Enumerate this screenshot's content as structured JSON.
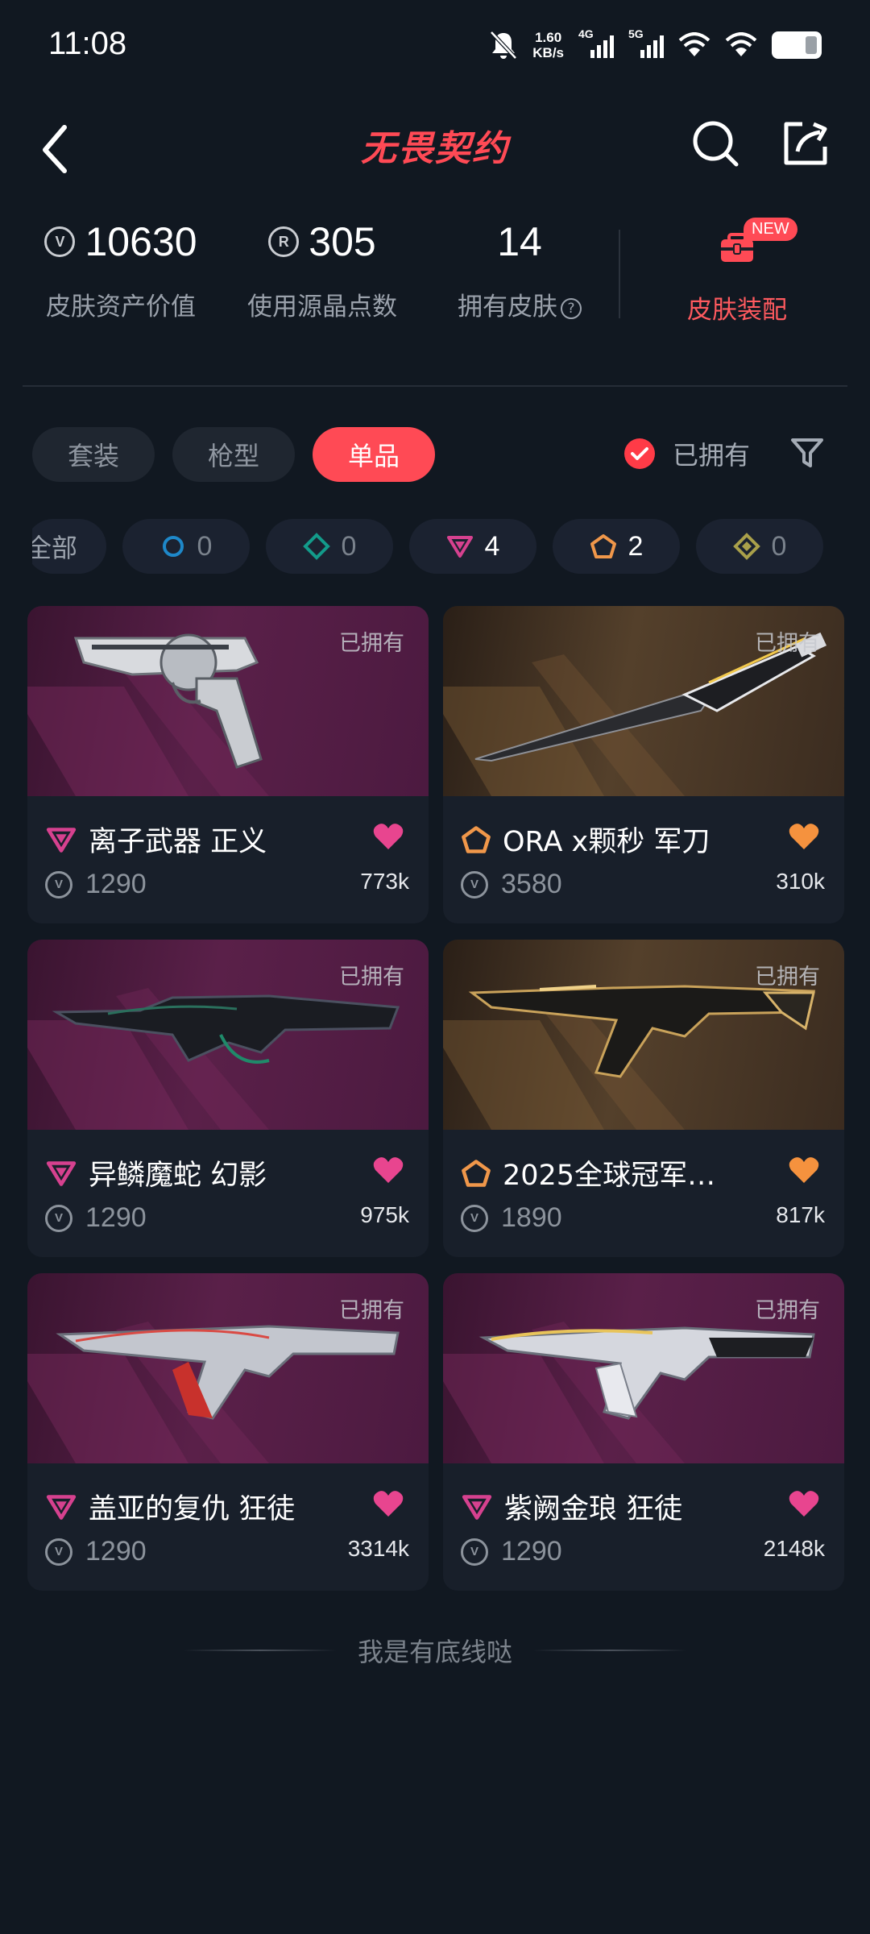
{
  "status": {
    "time": "11:08",
    "net_speed_value": "1.60",
    "net_speed_unit": "KB/s",
    "sig1_label": "4G",
    "sig2_label": "5G"
  },
  "header": {
    "title": "无畏契约"
  },
  "stats": {
    "asset_value": "10630",
    "asset_label": "皮肤资产价值",
    "radianite": "305",
    "radianite_label": "使用源晶点数",
    "skins_owned": "14",
    "skins_owned_label": "拥有皮肤",
    "loadout_label": "皮肤装配",
    "new_badge": "NEW",
    "coin_glyph": "V",
    "radianite_glyph": "R"
  },
  "tabs": [
    "套装",
    "枪型",
    "单品"
  ],
  "owned_filter_label": "已拥有",
  "rarity_chips": [
    {
      "label": "全部",
      "count": ""
    },
    {
      "count": "0",
      "tier": "select",
      "color": "#1e88c9"
    },
    {
      "count": "0",
      "tier": "deluxe",
      "color": "#139b8a"
    },
    {
      "count": "4",
      "tier": "premium",
      "color": "#d6418f"
    },
    {
      "count": "2",
      "tier": "exclusive",
      "color": "#f0974a"
    },
    {
      "count": "0",
      "tier": "ultra",
      "color": "#a9a04a"
    }
  ],
  "skins": [
    {
      "name": "离子武器 正义",
      "price": "1290",
      "likes": "773k",
      "owned": "已拥有",
      "tier": "premium",
      "heart_color": "#e8458f"
    },
    {
      "name": "ORA x颗秒 军刀",
      "price": "3580",
      "likes": "310k",
      "owned": "已拥有",
      "tier": "exclusive",
      "heart_color": "#f5923e"
    },
    {
      "name": "异鳞魔蛇 幻影",
      "price": "1290",
      "likes": "975k",
      "owned": "已拥有",
      "tier": "premium",
      "heart_color": "#e8458f"
    },
    {
      "name": "2025全球冠军…",
      "price": "1890",
      "likes": "817k",
      "owned": "已拥有",
      "tier": "exclusive",
      "heart_color": "#f5923e"
    },
    {
      "name": "盖亚的复仇 狂徒",
      "price": "1290",
      "likes": "3314k",
      "owned": "已拥有",
      "tier": "premium",
      "heart_color": "#e8458f"
    },
    {
      "name": "紫阙金琅 狂徒",
      "price": "1290",
      "likes": "2148k",
      "owned": "已拥有",
      "tier": "premium",
      "heart_color": "#e8458f"
    }
  ],
  "footer": "我是有底线哒",
  "colors": {
    "accent": "#ff4a55",
    "background": "#111821",
    "premium": "#d6418f",
    "exclusive": "#f0974a"
  }
}
